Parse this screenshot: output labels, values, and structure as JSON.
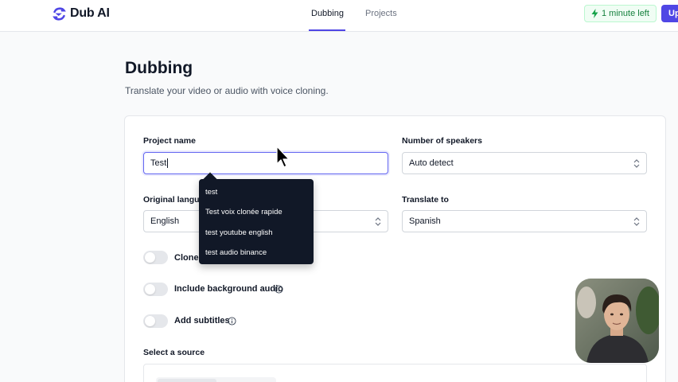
{
  "app": {
    "name": "Dub AI"
  },
  "nav": {
    "tabs": [
      {
        "label": "Dubbing"
      },
      {
        "label": "Projects"
      }
    ]
  },
  "header": {
    "credits_label": "1 minute left",
    "upgrade_label": "Up"
  },
  "page": {
    "title": "Dubbing",
    "subtitle": "Translate your video or audio with voice cloning."
  },
  "form": {
    "project_name": {
      "label": "Project name",
      "value": "Test"
    },
    "speakers": {
      "label": "Number of speakers",
      "value": "Auto detect"
    },
    "original_language": {
      "label": "Original langua",
      "value": "English"
    },
    "translate_to": {
      "label": "Translate to",
      "value": "Spanish"
    },
    "toggles": [
      {
        "label": "Clone",
        "on": false
      },
      {
        "label": "Include background audio",
        "on": false
      },
      {
        "label": "Add subtitles",
        "on": false
      }
    ],
    "source": {
      "label": "Select a source"
    }
  },
  "autocomplete": {
    "items": [
      "test",
      "Test voix clonée rapide",
      "test youtube english",
      "test audio binance"
    ]
  },
  "colors": {
    "accent": "#4f46e5",
    "success": "#15803d",
    "tooltip_bg": "#111827"
  }
}
